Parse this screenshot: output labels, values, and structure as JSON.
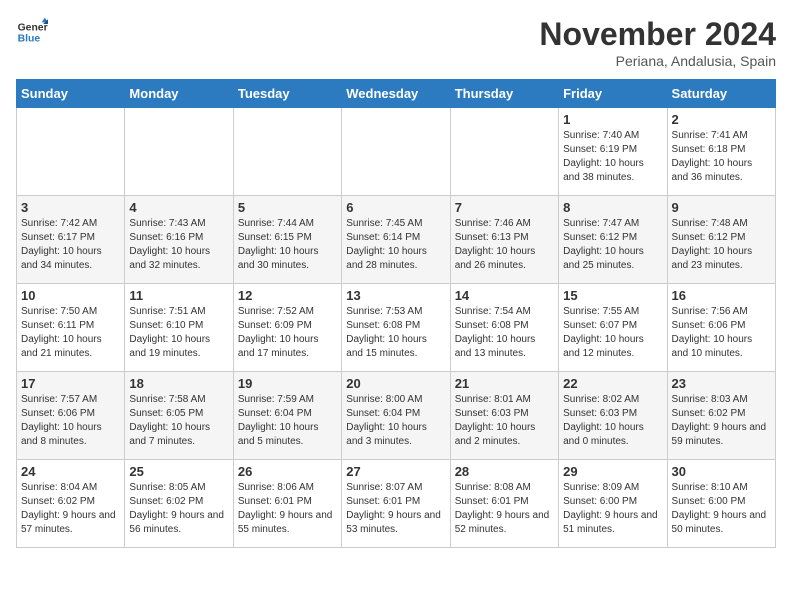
{
  "header": {
    "logo_line1": "General",
    "logo_line2": "Blue",
    "title": "November 2024",
    "subtitle": "Periana, Andalusia, Spain"
  },
  "days_of_week": [
    "Sunday",
    "Monday",
    "Tuesday",
    "Wednesday",
    "Thursday",
    "Friday",
    "Saturday"
  ],
  "weeks": [
    [
      {
        "day": "",
        "info": ""
      },
      {
        "day": "",
        "info": ""
      },
      {
        "day": "",
        "info": ""
      },
      {
        "day": "",
        "info": ""
      },
      {
        "day": "",
        "info": ""
      },
      {
        "day": "1",
        "info": "Sunrise: 7:40 AM\nSunset: 6:19 PM\nDaylight: 10 hours and 38 minutes."
      },
      {
        "day": "2",
        "info": "Sunrise: 7:41 AM\nSunset: 6:18 PM\nDaylight: 10 hours and 36 minutes."
      }
    ],
    [
      {
        "day": "3",
        "info": "Sunrise: 7:42 AM\nSunset: 6:17 PM\nDaylight: 10 hours and 34 minutes."
      },
      {
        "day": "4",
        "info": "Sunrise: 7:43 AM\nSunset: 6:16 PM\nDaylight: 10 hours and 32 minutes."
      },
      {
        "day": "5",
        "info": "Sunrise: 7:44 AM\nSunset: 6:15 PM\nDaylight: 10 hours and 30 minutes."
      },
      {
        "day": "6",
        "info": "Sunrise: 7:45 AM\nSunset: 6:14 PM\nDaylight: 10 hours and 28 minutes."
      },
      {
        "day": "7",
        "info": "Sunrise: 7:46 AM\nSunset: 6:13 PM\nDaylight: 10 hours and 26 minutes."
      },
      {
        "day": "8",
        "info": "Sunrise: 7:47 AM\nSunset: 6:12 PM\nDaylight: 10 hours and 25 minutes."
      },
      {
        "day": "9",
        "info": "Sunrise: 7:48 AM\nSunset: 6:12 PM\nDaylight: 10 hours and 23 minutes."
      }
    ],
    [
      {
        "day": "10",
        "info": "Sunrise: 7:50 AM\nSunset: 6:11 PM\nDaylight: 10 hours and 21 minutes."
      },
      {
        "day": "11",
        "info": "Sunrise: 7:51 AM\nSunset: 6:10 PM\nDaylight: 10 hours and 19 minutes."
      },
      {
        "day": "12",
        "info": "Sunrise: 7:52 AM\nSunset: 6:09 PM\nDaylight: 10 hours and 17 minutes."
      },
      {
        "day": "13",
        "info": "Sunrise: 7:53 AM\nSunset: 6:08 PM\nDaylight: 10 hours and 15 minutes."
      },
      {
        "day": "14",
        "info": "Sunrise: 7:54 AM\nSunset: 6:08 PM\nDaylight: 10 hours and 13 minutes."
      },
      {
        "day": "15",
        "info": "Sunrise: 7:55 AM\nSunset: 6:07 PM\nDaylight: 10 hours and 12 minutes."
      },
      {
        "day": "16",
        "info": "Sunrise: 7:56 AM\nSunset: 6:06 PM\nDaylight: 10 hours and 10 minutes."
      }
    ],
    [
      {
        "day": "17",
        "info": "Sunrise: 7:57 AM\nSunset: 6:06 PM\nDaylight: 10 hours and 8 minutes."
      },
      {
        "day": "18",
        "info": "Sunrise: 7:58 AM\nSunset: 6:05 PM\nDaylight: 10 hours and 7 minutes."
      },
      {
        "day": "19",
        "info": "Sunrise: 7:59 AM\nSunset: 6:04 PM\nDaylight: 10 hours and 5 minutes."
      },
      {
        "day": "20",
        "info": "Sunrise: 8:00 AM\nSunset: 6:04 PM\nDaylight: 10 hours and 3 minutes."
      },
      {
        "day": "21",
        "info": "Sunrise: 8:01 AM\nSunset: 6:03 PM\nDaylight: 10 hours and 2 minutes."
      },
      {
        "day": "22",
        "info": "Sunrise: 8:02 AM\nSunset: 6:03 PM\nDaylight: 10 hours and 0 minutes."
      },
      {
        "day": "23",
        "info": "Sunrise: 8:03 AM\nSunset: 6:02 PM\nDaylight: 9 hours and 59 minutes."
      }
    ],
    [
      {
        "day": "24",
        "info": "Sunrise: 8:04 AM\nSunset: 6:02 PM\nDaylight: 9 hours and 57 minutes."
      },
      {
        "day": "25",
        "info": "Sunrise: 8:05 AM\nSunset: 6:02 PM\nDaylight: 9 hours and 56 minutes."
      },
      {
        "day": "26",
        "info": "Sunrise: 8:06 AM\nSunset: 6:01 PM\nDaylight: 9 hours and 55 minutes."
      },
      {
        "day": "27",
        "info": "Sunrise: 8:07 AM\nSunset: 6:01 PM\nDaylight: 9 hours and 53 minutes."
      },
      {
        "day": "28",
        "info": "Sunrise: 8:08 AM\nSunset: 6:01 PM\nDaylight: 9 hours and 52 minutes."
      },
      {
        "day": "29",
        "info": "Sunrise: 8:09 AM\nSunset: 6:00 PM\nDaylight: 9 hours and 51 minutes."
      },
      {
        "day": "30",
        "info": "Sunrise: 8:10 AM\nSunset: 6:00 PM\nDaylight: 9 hours and 50 minutes."
      }
    ]
  ]
}
